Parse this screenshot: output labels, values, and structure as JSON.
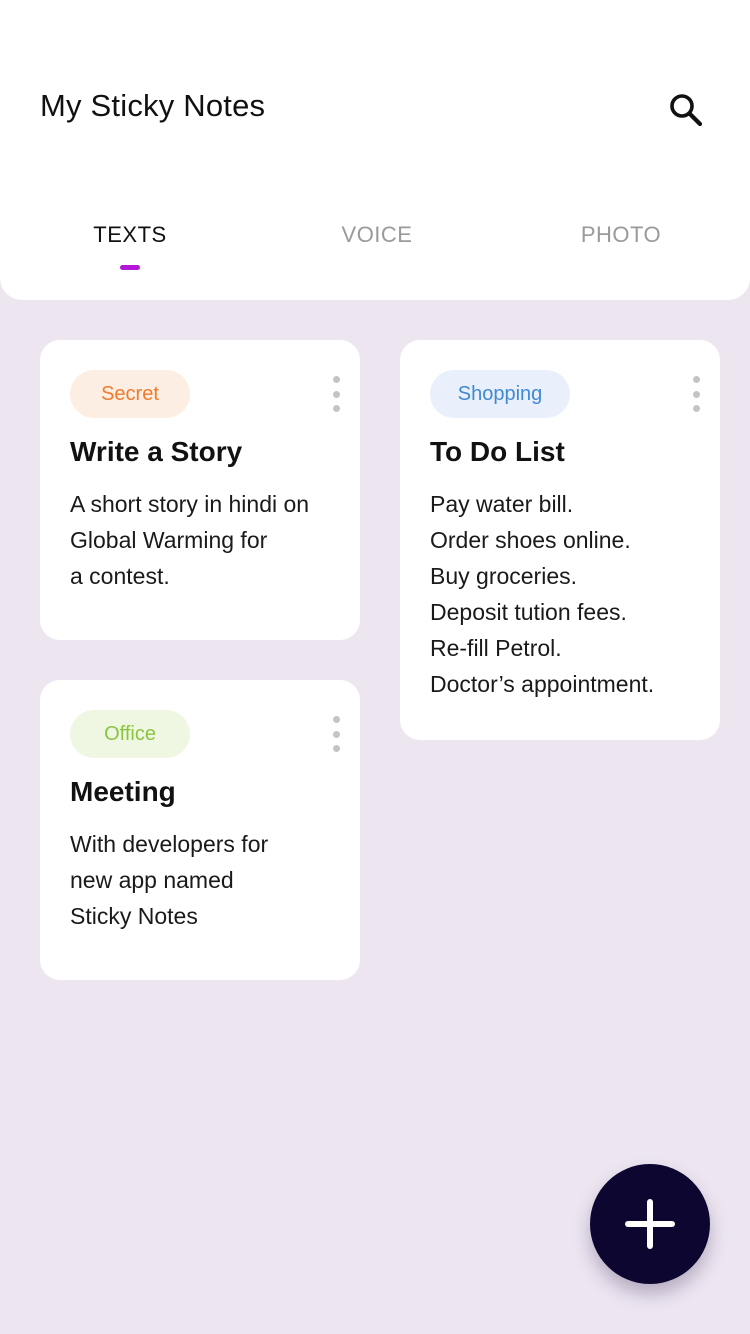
{
  "header": {
    "title": "My Sticky Notes",
    "search_icon": "search-icon"
  },
  "tabs": [
    {
      "label": "TEXTS",
      "active": true
    },
    {
      "label": "VOICE",
      "active": false
    },
    {
      "label": "PHOTO",
      "active": false
    }
  ],
  "colors": {
    "accent": "#b517d6",
    "background": "#ede6f1",
    "fab": "#0d0630",
    "secret": "#ef7b2c",
    "shopping": "#3f88d6",
    "office": "#8bc43f"
  },
  "notes": [
    {
      "tag": "Secret",
      "title": "Write a Story",
      "lines": [
        "A short story in hindi on",
        "Global Warming for",
        "a contest."
      ]
    },
    {
      "tag": "Shopping",
      "title": "To Do List",
      "lines": [
        "Pay water bill.",
        "Order shoes online.",
        "Buy groceries.",
        "Deposit tution fees.",
        "Re-fill Petrol.",
        "Doctor’s appointment."
      ]
    },
    {
      "tag": "Office",
      "title": "Meeting",
      "lines": [
        "With developers for",
        "new app named",
        "Sticky Notes"
      ]
    }
  ],
  "fab": {
    "icon": "plus-icon"
  }
}
